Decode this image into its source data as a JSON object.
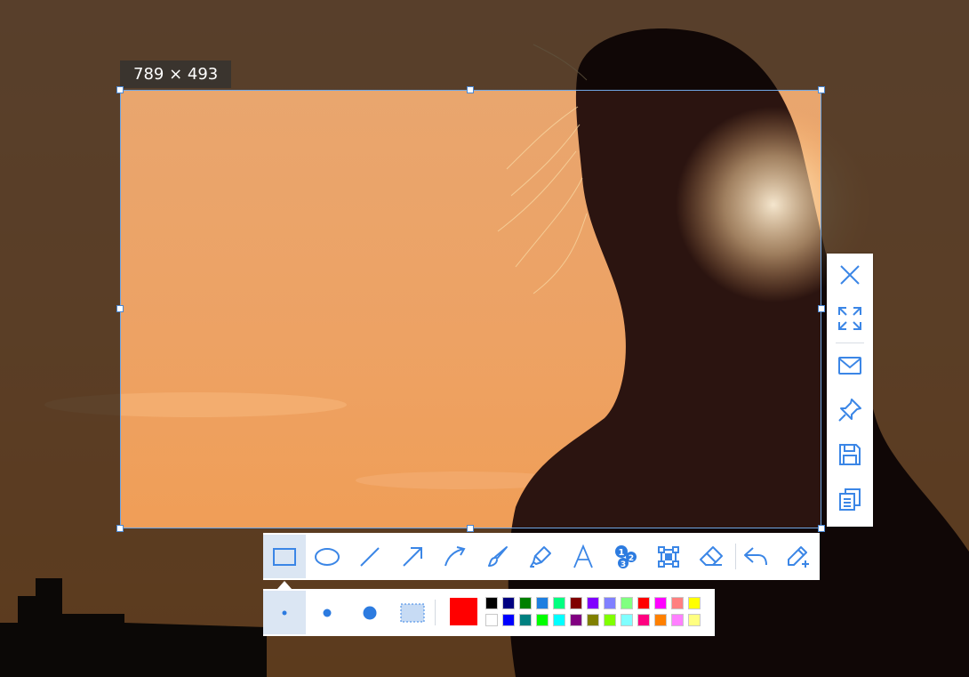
{
  "selection": {
    "size_label": "789 × 493"
  },
  "side_toolbar": {
    "items": [
      {
        "name": "close-button",
        "icon": "close-icon"
      },
      {
        "name": "fullscreen-button",
        "icon": "expand-icon"
      },
      {
        "name": "email-button",
        "icon": "mail-icon"
      },
      {
        "name": "pin-button",
        "icon": "pin-icon"
      },
      {
        "name": "save-button",
        "icon": "save-icon"
      },
      {
        "name": "copy-button",
        "icon": "copy-icon"
      }
    ]
  },
  "draw_toolbar": {
    "tools": [
      {
        "name": "rectangle-tool",
        "icon": "rectangle-icon",
        "active": true
      },
      {
        "name": "ellipse-tool",
        "icon": "ellipse-icon"
      },
      {
        "name": "line-tool",
        "icon": "line-icon"
      },
      {
        "name": "arrow-tool",
        "icon": "arrow-icon"
      },
      {
        "name": "curved-arrow-tool",
        "icon": "curved-arrow-icon"
      },
      {
        "name": "brush-tool",
        "icon": "brush-icon"
      },
      {
        "name": "highlighter-tool",
        "icon": "highlighter-icon"
      },
      {
        "name": "text-tool",
        "icon": "text-icon",
        "glyph": "A"
      },
      {
        "name": "number-tool",
        "icon": "numbered-steps-icon",
        "digits": [
          "1",
          "2",
          "3"
        ]
      },
      {
        "name": "mosaic-tool",
        "icon": "mosaic-icon"
      },
      {
        "name": "eraser-tool",
        "icon": "eraser-icon"
      },
      {
        "name": "undo-button",
        "icon": "undo-icon"
      },
      {
        "name": "edit-finish-button",
        "icon": "pen-plus-icon"
      }
    ]
  },
  "options": {
    "sizes": [
      "small",
      "medium",
      "large",
      "dotted-fill"
    ],
    "current_color": "#ff0000",
    "palette_top": [
      "#000000",
      "#000080",
      "#008000",
      "#1e7fe0",
      "#00ff80",
      "#800000",
      "#8000ff",
      "#8080ff",
      "#80ff80",
      "#ff0000",
      "#ff00ff",
      "#ff8080",
      "#ffff00"
    ],
    "palette_bottom": [
      "#ffffff",
      "#0000ff",
      "#008080",
      "#00ff00",
      "#00ffff",
      "#800080",
      "#808000",
      "#80ff00",
      "#80ffff",
      "#ff0080",
      "#ff8000",
      "#ff80ff",
      "#ffff80"
    ]
  },
  "colors": {
    "accent": "#2c7be0",
    "icon": "#3b86e6"
  }
}
